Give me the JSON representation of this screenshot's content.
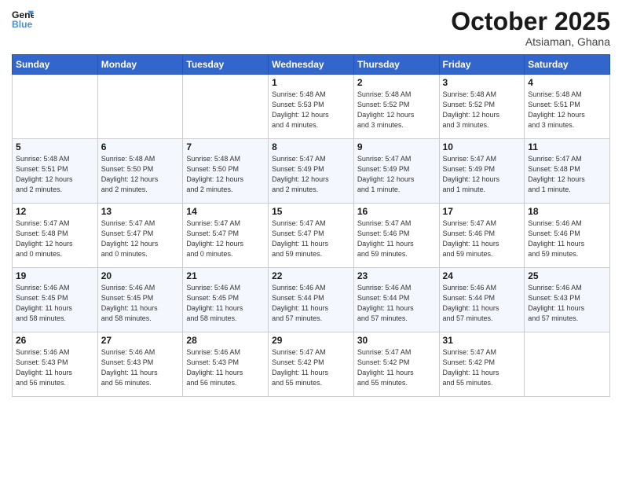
{
  "header": {
    "logo_line1": "General",
    "logo_line2": "Blue",
    "month": "October 2025",
    "location": "Atsiaman, Ghana"
  },
  "weekdays": [
    "Sunday",
    "Monday",
    "Tuesday",
    "Wednesday",
    "Thursday",
    "Friday",
    "Saturday"
  ],
  "weeks": [
    [
      {
        "day": "",
        "info": ""
      },
      {
        "day": "",
        "info": ""
      },
      {
        "day": "",
        "info": ""
      },
      {
        "day": "1",
        "info": "Sunrise: 5:48 AM\nSunset: 5:53 PM\nDaylight: 12 hours\nand 4 minutes."
      },
      {
        "day": "2",
        "info": "Sunrise: 5:48 AM\nSunset: 5:52 PM\nDaylight: 12 hours\nand 3 minutes."
      },
      {
        "day": "3",
        "info": "Sunrise: 5:48 AM\nSunset: 5:52 PM\nDaylight: 12 hours\nand 3 minutes."
      },
      {
        "day": "4",
        "info": "Sunrise: 5:48 AM\nSunset: 5:51 PM\nDaylight: 12 hours\nand 3 minutes."
      }
    ],
    [
      {
        "day": "5",
        "info": "Sunrise: 5:48 AM\nSunset: 5:51 PM\nDaylight: 12 hours\nand 2 minutes."
      },
      {
        "day": "6",
        "info": "Sunrise: 5:48 AM\nSunset: 5:50 PM\nDaylight: 12 hours\nand 2 minutes."
      },
      {
        "day": "7",
        "info": "Sunrise: 5:48 AM\nSunset: 5:50 PM\nDaylight: 12 hours\nand 2 minutes."
      },
      {
        "day": "8",
        "info": "Sunrise: 5:47 AM\nSunset: 5:49 PM\nDaylight: 12 hours\nand 2 minutes."
      },
      {
        "day": "9",
        "info": "Sunrise: 5:47 AM\nSunset: 5:49 PM\nDaylight: 12 hours\nand 1 minute."
      },
      {
        "day": "10",
        "info": "Sunrise: 5:47 AM\nSunset: 5:49 PM\nDaylight: 12 hours\nand 1 minute."
      },
      {
        "day": "11",
        "info": "Sunrise: 5:47 AM\nSunset: 5:48 PM\nDaylight: 12 hours\nand 1 minute."
      }
    ],
    [
      {
        "day": "12",
        "info": "Sunrise: 5:47 AM\nSunset: 5:48 PM\nDaylight: 12 hours\nand 0 minutes."
      },
      {
        "day": "13",
        "info": "Sunrise: 5:47 AM\nSunset: 5:47 PM\nDaylight: 12 hours\nand 0 minutes."
      },
      {
        "day": "14",
        "info": "Sunrise: 5:47 AM\nSunset: 5:47 PM\nDaylight: 12 hours\nand 0 minutes."
      },
      {
        "day": "15",
        "info": "Sunrise: 5:47 AM\nSunset: 5:47 PM\nDaylight: 11 hours\nand 59 minutes."
      },
      {
        "day": "16",
        "info": "Sunrise: 5:47 AM\nSunset: 5:46 PM\nDaylight: 11 hours\nand 59 minutes."
      },
      {
        "day": "17",
        "info": "Sunrise: 5:47 AM\nSunset: 5:46 PM\nDaylight: 11 hours\nand 59 minutes."
      },
      {
        "day": "18",
        "info": "Sunrise: 5:46 AM\nSunset: 5:46 PM\nDaylight: 11 hours\nand 59 minutes."
      }
    ],
    [
      {
        "day": "19",
        "info": "Sunrise: 5:46 AM\nSunset: 5:45 PM\nDaylight: 11 hours\nand 58 minutes."
      },
      {
        "day": "20",
        "info": "Sunrise: 5:46 AM\nSunset: 5:45 PM\nDaylight: 11 hours\nand 58 minutes."
      },
      {
        "day": "21",
        "info": "Sunrise: 5:46 AM\nSunset: 5:45 PM\nDaylight: 11 hours\nand 58 minutes."
      },
      {
        "day": "22",
        "info": "Sunrise: 5:46 AM\nSunset: 5:44 PM\nDaylight: 11 hours\nand 57 minutes."
      },
      {
        "day": "23",
        "info": "Sunrise: 5:46 AM\nSunset: 5:44 PM\nDaylight: 11 hours\nand 57 minutes."
      },
      {
        "day": "24",
        "info": "Sunrise: 5:46 AM\nSunset: 5:44 PM\nDaylight: 11 hours\nand 57 minutes."
      },
      {
        "day": "25",
        "info": "Sunrise: 5:46 AM\nSunset: 5:43 PM\nDaylight: 11 hours\nand 57 minutes."
      }
    ],
    [
      {
        "day": "26",
        "info": "Sunrise: 5:46 AM\nSunset: 5:43 PM\nDaylight: 11 hours\nand 56 minutes."
      },
      {
        "day": "27",
        "info": "Sunrise: 5:46 AM\nSunset: 5:43 PM\nDaylight: 11 hours\nand 56 minutes."
      },
      {
        "day": "28",
        "info": "Sunrise: 5:46 AM\nSunset: 5:43 PM\nDaylight: 11 hours\nand 56 minutes."
      },
      {
        "day": "29",
        "info": "Sunrise: 5:47 AM\nSunset: 5:42 PM\nDaylight: 11 hours\nand 55 minutes."
      },
      {
        "day": "30",
        "info": "Sunrise: 5:47 AM\nSunset: 5:42 PM\nDaylight: 11 hours\nand 55 minutes."
      },
      {
        "day": "31",
        "info": "Sunrise: 5:47 AM\nSunset: 5:42 PM\nDaylight: 11 hours\nand 55 minutes."
      },
      {
        "day": "",
        "info": ""
      }
    ]
  ]
}
